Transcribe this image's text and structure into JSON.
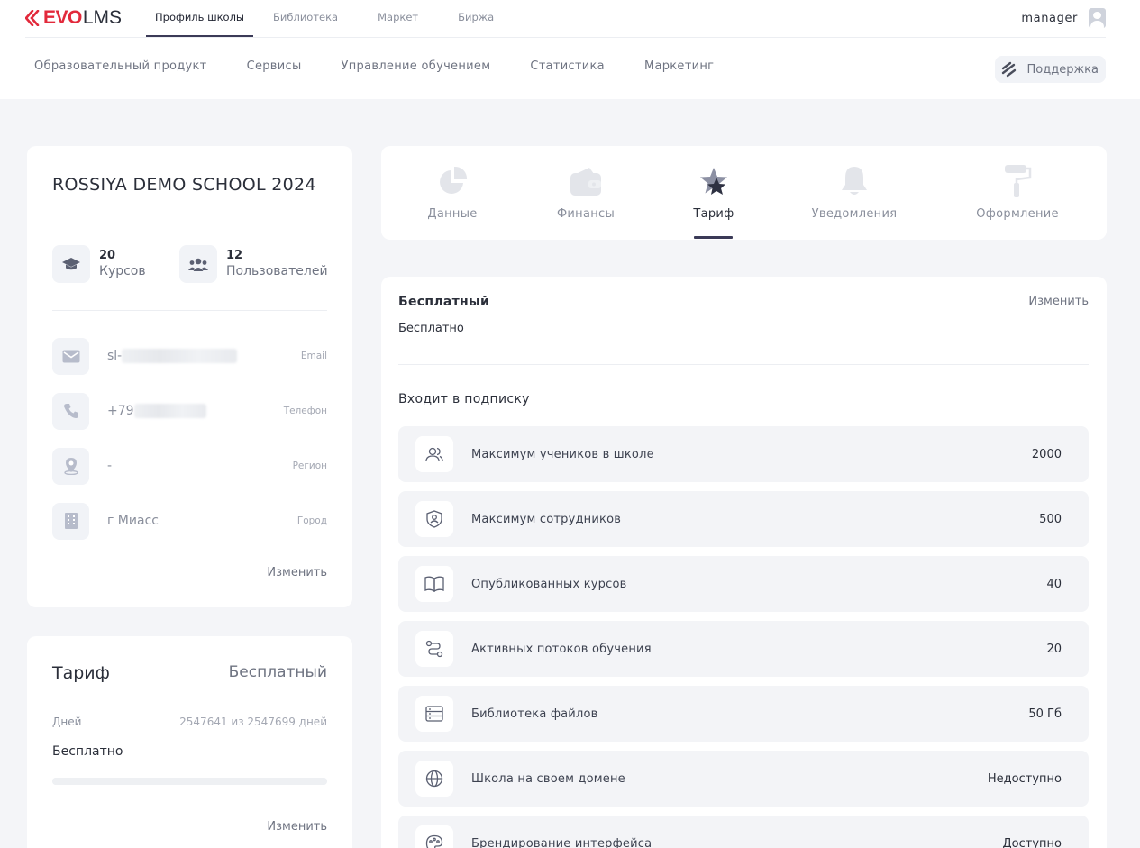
{
  "brand": {
    "evo": "EVO",
    "lms": "LMS",
    "accent": "#e2293b"
  },
  "top_tabs": [
    {
      "label": "Профиль школы",
      "active": true
    },
    {
      "label": "Библиотека",
      "active": false
    },
    {
      "label": "Маркет",
      "active": false
    },
    {
      "label": "Биржа",
      "active": false
    }
  ],
  "user": {
    "name": "manager",
    "icon": "user-avatar-icon"
  },
  "main_nav": [
    "Образовательный продукт",
    "Сервисы",
    "Управление обучением",
    "Статистика",
    "Маркетинг"
  ],
  "support": {
    "label": "Поддержка",
    "icon": "support-logo-icon"
  },
  "school": {
    "title": "ROSSIYA DEMO SCHOOL 2024",
    "courses_count": "20",
    "courses_label": "Курсов",
    "users_count": "12",
    "users_label": "Пользователей",
    "contacts": [
      {
        "icon": "mail-icon",
        "value": "sl-",
        "label": "Email"
      },
      {
        "icon": "phone-icon",
        "value": "+79",
        "label": "Телефон"
      },
      {
        "icon": "map-pin-icon",
        "value": "-",
        "label": "Регион"
      },
      {
        "icon": "city-building-icon",
        "value": "г Миасс",
        "label": "Город"
      }
    ],
    "edit_label": "Изменить"
  },
  "tariff_summary": {
    "title": "Тариф",
    "plan": "Бесплатный",
    "days_label": "Дней",
    "days_value": "2547641 из 2547699 дней",
    "price": "Бесплатно",
    "progress_fraction": 0.99998,
    "edit_label": "Изменить"
  },
  "profile_tabs": [
    {
      "label": "Данные",
      "icon": "pie-chart-icon",
      "active": false
    },
    {
      "label": "Финансы",
      "icon": "wallet-icon",
      "active": false
    },
    {
      "label": "Тариф",
      "icon": "star-icon",
      "active": true
    },
    {
      "label": "Уведомления",
      "icon": "bell-icon",
      "active": false
    },
    {
      "label": "Оформление",
      "icon": "paint-roller-icon",
      "active": false
    }
  ],
  "subscription": {
    "plan": "Бесплатный",
    "edit_label": "Изменить",
    "price": "Бесплатно",
    "included_title": "Входит в подписку",
    "features": [
      {
        "icon": "users-icon",
        "label": "Максимум учеников в школе",
        "value": "2000"
      },
      {
        "icon": "staff-shield-icon",
        "label": "Максимум сотрудников",
        "value": "500"
      },
      {
        "icon": "book-open-icon",
        "label": "Опубликованных курсов",
        "value": "40"
      },
      {
        "icon": "route-icon",
        "label": "Активных потоков обучения",
        "value": "20"
      },
      {
        "icon": "file-library-icon",
        "label": "Библиотека файлов",
        "value": "50 Гб"
      },
      {
        "icon": "globe-icon",
        "label": "Школа на своем домене",
        "value": "Недоступно"
      },
      {
        "icon": "palette-icon",
        "label": "Брендирование интерфейса",
        "value": "Доступно"
      }
    ]
  }
}
